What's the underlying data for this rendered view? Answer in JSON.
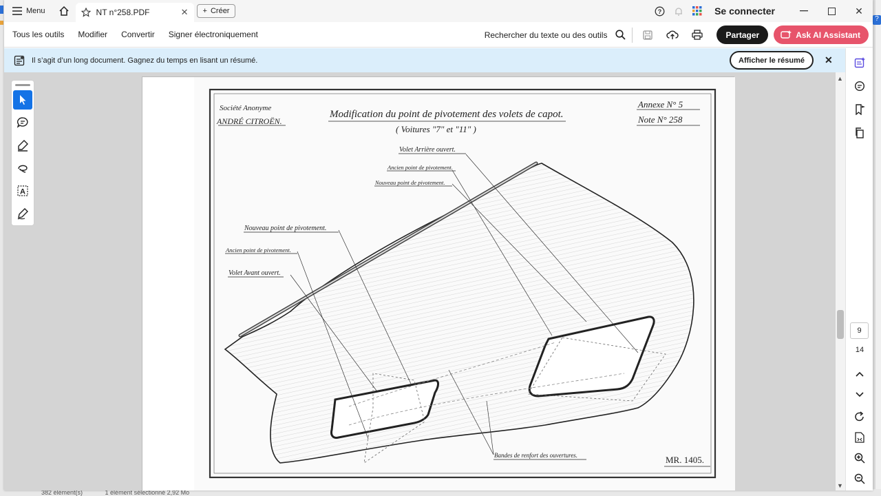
{
  "titlebar": {
    "menu_label": "Menu",
    "tab_title": "NT n°258.PDF",
    "create_label": "Créer",
    "signin_label": "Se connecter"
  },
  "toolbar": {
    "items": [
      "Tous les outils",
      "Modifier",
      "Convertir",
      "Signer électroniquement"
    ],
    "search_label": "Rechercher du texte ou des outils",
    "share_label": "Partager",
    "ai_label": "Ask AI Assistant"
  },
  "banner": {
    "text": "Il s’agit d’un long document. Gagnez du temps en lisant un résumé.",
    "summary_button": "Afficher le résumé"
  },
  "navigation": {
    "current_page": "9",
    "total_pages": "14"
  },
  "status_bar": {
    "items": [
      "382 élément(s)",
      "1 élément sélectionné  2,92 Mo"
    ]
  },
  "drawing": {
    "company_line1": "Société Anonyme",
    "company_line2": "ANDRÉ CITROËN.",
    "title": "Modification du point de pivotement des volets de capot.",
    "subtitle": "( Voitures \"7\" et \"11\" )",
    "annex": "Annexe N° 5",
    "note": "Note N° 258",
    "labels": {
      "rear_open": "Volet Arrière ouvert.",
      "old_pivot_rear": "Ancien point de pivotement.",
      "new_pivot_rear": "Nouveau point de pivotement.",
      "new_pivot_front": "Nouveau point de pivotement.",
      "old_pivot_front": "Ancien point de pivotement.",
      "front_open": "Volet Avant ouvert.",
      "reinforcement": "Bandes de renfort des ouvertures.",
      "reference": "MR. 1405."
    }
  }
}
